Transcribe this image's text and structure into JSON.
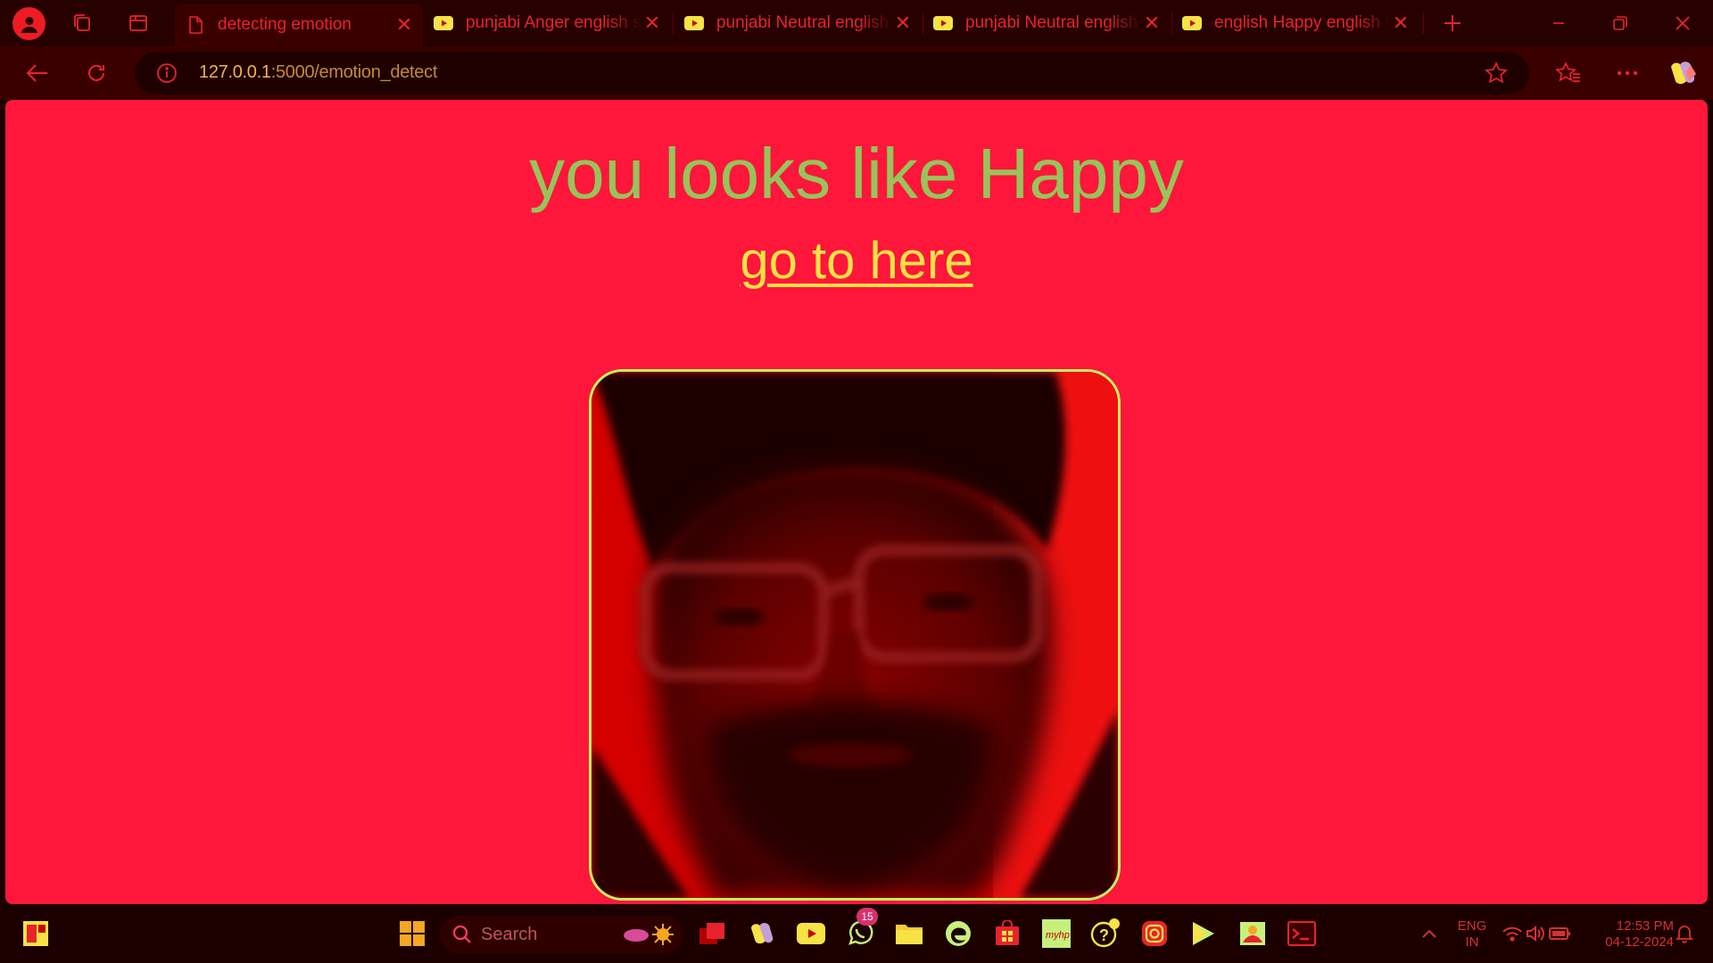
{
  "browser": {
    "tabs": [
      {
        "title": "detecting emotion",
        "favicon": "document-icon",
        "active": true
      },
      {
        "title": "punjabi Anger english songs",
        "favicon": "youtube-icon",
        "active": false
      },
      {
        "title": "punjabi Neutral english songs",
        "favicon": "youtube-icon",
        "active": false
      },
      {
        "title": "punjabi Neutral english songs",
        "favicon": "youtube-icon",
        "active": false
      },
      {
        "title": "english Happy english songs",
        "favicon": "youtube-icon",
        "active": false
      }
    ],
    "address": {
      "host": "127.0.0.1",
      "rest": ":5000/emotion_detect"
    }
  },
  "page": {
    "headline": "you looks like Happy",
    "link_text": "go to here",
    "image_label": "face-photo"
  },
  "taskbar": {
    "search_placeholder": "Search",
    "whatsapp_badge": "15",
    "language": {
      "line1": "ENG",
      "line2": "IN"
    },
    "clock": {
      "time": "12:53 PM",
      "date": "04-12-2024"
    }
  },
  "colors": {
    "accent_red": "#e8232d",
    "page_bg": "#fe163b",
    "headline": "#97c45a",
    "link": "#f7e346",
    "photo_border": "#b9f260"
  }
}
